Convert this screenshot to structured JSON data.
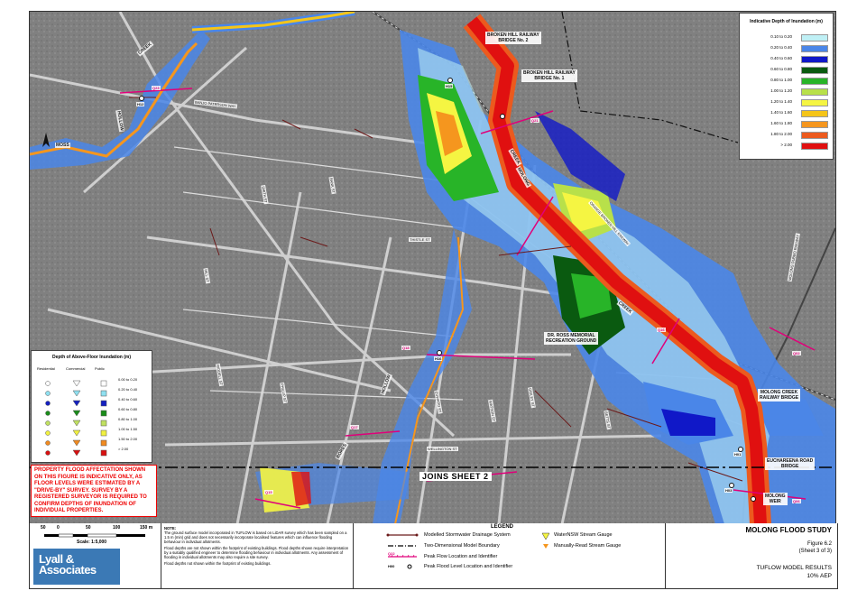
{
  "main_legend": {
    "title": "Indicative Depth of Inundation (m)",
    "classes": [
      {
        "label": "0.10 to 0.20",
        "color": "#bff0f5"
      },
      {
        "label": "0.20 to 0.40",
        "color": "#4a86e8"
      },
      {
        "label": "0.40 to 0.60",
        "color": "#1018c8"
      },
      {
        "label": "0.60 to 0.80",
        "color": "#0a5a10"
      },
      {
        "label": "0.80 to 1.00",
        "color": "#28b428"
      },
      {
        "label": "1.00 to 1.20",
        "color": "#b8e04a"
      },
      {
        "label": "1.20 to 1.40",
        "color": "#f5f542"
      },
      {
        "label": "1.40 to 1.60",
        "color": "#f5c518"
      },
      {
        "label": "1.60 to 1.80",
        "color": "#f5961e"
      },
      {
        "label": "1.80 to 2.00",
        "color": "#ec5a1e"
      },
      {
        "label": "> 2.00",
        "color": "#e01010"
      }
    ]
  },
  "afl_legend": {
    "title": "Depth of Above-Floor Inundation (m)",
    "headers": {
      "residential": "Residential",
      "commercial": "Commercial",
      "public": "Public"
    },
    "classes": [
      {
        "label": "0.00 to 0.20",
        "color": "#ffffff"
      },
      {
        "label": "0.20 to 0.40",
        "color": "#8fe0f0"
      },
      {
        "label": "0.40 to 0.60",
        "color": "#1520c0"
      },
      {
        "label": "0.60 to 0.80",
        "color": "#1a8c1a"
      },
      {
        "label": "0.80 to 1.00",
        "color": "#c0e060"
      },
      {
        "label": "1.00 to 1.50",
        "color": "#f0f040"
      },
      {
        "label": "1.50 to 2.00",
        "color": "#f08a20"
      },
      {
        "label": "> 2.00",
        "color": "#d81010"
      }
    ]
  },
  "map_labels": {
    "bridge1": "BROKEN HILL RAILWAY\nBRIDGE No. 2",
    "bridge2": "BROKEN HILL RAILWAY\nBRIDGE No. 1",
    "recreation": "DR. ROSS MEMORIAL\nRECREATION GROUND",
    "molong_creek_bridge": "MOLONG CREEK\nRAILWAY BRIDGE",
    "euchareena": "EUCHAREENA ROAD\nBRIDGE",
    "weir": "MOLONG\nWEIR",
    "creek1": "CREEK",
    "hollow1": "HOLLOW",
    "moss": "MOSS",
    "molong": "MOLONG",
    "creek2": "CREEK",
    "creek3": "CREEK",
    "hollow2": "HOLLOW",
    "bores": "BORES",
    "railway_label": "ORANGE BROKEN HILL RAILWAY",
    "dubbo_railway": "MOLONG DUBBO RAILWAY",
    "st_banjo": "BANJO PATERSON WAY",
    "st_smith": "SMITH ST",
    "st_bank": "BANK ST",
    "st_hill": "HILL ST",
    "st_riddell": "RIDDELL ST",
    "st_phillip": "PHILLIP ST",
    "st_edward": "EDWARD ST",
    "st_watson": "WATSON ST",
    "st_gidley": "GIDLEY ST",
    "st_wellington": "WELLINGTON ST",
    "st_betts": "BETTS ST",
    "st_thistle": "THISTLE ST",
    "q23": "Q23",
    "q21": "Q21",
    "q18": "Q18",
    "q16": "Q16",
    "q17": "Q17",
    "q02": "Q02",
    "q15": "Q15",
    "q06": "Q06",
    "h15": "H15",
    "h12": "H12",
    "h16": "H16",
    "h03": "H03",
    "h01": "H01",
    "joins": "JOINS SHEET 2"
  },
  "warning": "PROPERTY FLOOD AFFECTATION SHOWN ON THIS FIGURE IS INDICATIVE ONLY, AS FLOOR LEVELS WERE ESTIMATED BY A \"DRIVE-BY\" SURVEY. SURVEY BY A REGISTERED SURVEYOR IS REQUIRED TO CONFIRM DEPTHS OF INUNDATION OF INDIVIDUAL PROPERTIES.",
  "scale": {
    "ticks": [
      "50",
      "0",
      "50",
      "100",
      "150 m"
    ],
    "label": "Scale: 1:5,000"
  },
  "logo": {
    "line1": "Lyall &",
    "line2": "Associates"
  },
  "note": {
    "title": "NOTE:",
    "p1": "The ground surface model incorporated in TUFLOW is based on LiDAR survey which has been sampled on a 1.5 m (min) grid and does not necessarily incorporate localised features which can influence flooding behaviour in individual allotments.",
    "p2": "Flood depths are not shown within the footprint of existing buildings. Flood depths shown require interpretation by a suitably qualified engineer to determine flooding behaviour in individual allotments. Any assessment of flooding in individual allotments may also require a site survey.",
    "p3": "Flood depths not shown within the footprint of existing buildings."
  },
  "bottom_legend": {
    "title": "LEGEND",
    "items": [
      "Modelled Stormwater Drainage System",
      "Two-Dimensional Model Boundary",
      "Peak Flow Location and Identifier",
      "Peak Flood Level Location and Identifier",
      "WaterNSW Stream Gauge",
      "Manually-Read Stream Gauge"
    ],
    "q_tag": "Q22",
    "h_tag": "H00"
  },
  "title_block": {
    "study": "MOLONG FLOOD STUDY",
    "figure": "Figure 6.2",
    "sheet": "(Sheet 3 of 3)",
    "results": "TUFLOW MODEL RESULTS",
    "aep": "10% AEP"
  }
}
